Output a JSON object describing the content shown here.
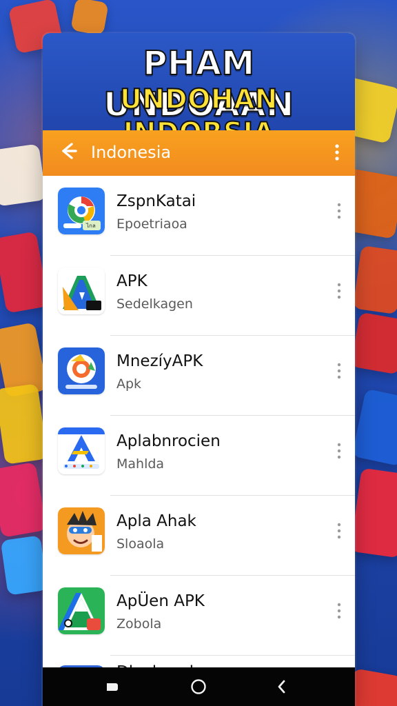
{
  "hero": {
    "line1": "PHAM UNDOAAN",
    "line2": "UNDOHAN INDORSIA"
  },
  "appbar": {
    "title": "Indonesia",
    "back_icon": "arrow-left-icon",
    "menu_icon": "more-vert-icon"
  },
  "apps": [
    {
      "title": "ZspnKatai",
      "subtitle": "Epoetriaoa",
      "badge": "ไกล"
    },
    {
      "title": "APK",
      "subtitle": "Sedelkagen"
    },
    {
      "title": "MnezíyAPK",
      "subtitle": "Apk"
    },
    {
      "title": "Aplabnrocien",
      "subtitle": "Mahlda"
    },
    {
      "title": "Apla Ahak",
      "subtitle": "Sloaola"
    },
    {
      "title": "ApÜen APK",
      "subtitle": "Zobola"
    },
    {
      "title": "Dlvalurark"
    }
  ],
  "navigation": {
    "recent_icon": "recent-apps-icon",
    "home_icon": "home-icon",
    "back_icon": "back-icon"
  },
  "colors": {
    "appbar": "#f39a1f",
    "hero": "#2349b5",
    "accent_yellow": "#ffe238"
  }
}
